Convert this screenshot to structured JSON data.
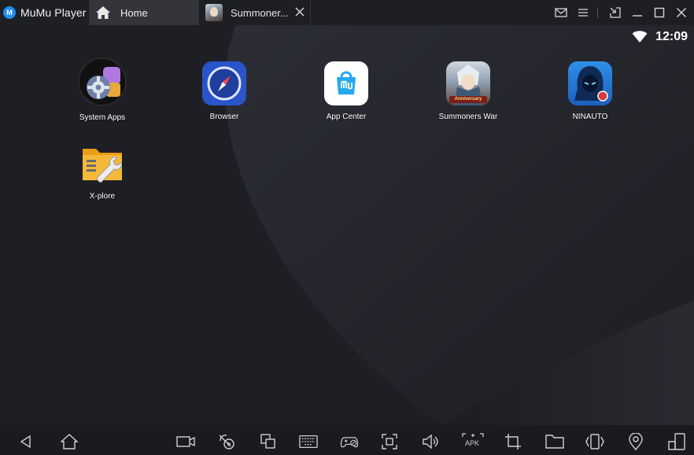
{
  "app": {
    "name": "MuMu Player",
    "logo_text": "M"
  },
  "tabs": [
    {
      "label": "Home"
    },
    {
      "label": "Summoner..."
    }
  ],
  "status": {
    "time": "12:09"
  },
  "apps": [
    {
      "label": "System Apps",
      "icon": "settings-gear-icon"
    },
    {
      "label": "Browser",
      "icon": "compass-icon"
    },
    {
      "label": "App Center",
      "icon": "shopping-bag-icon"
    },
    {
      "label": "Summoners War",
      "icon": "game-portrait-icon",
      "badge": "Anniversary"
    },
    {
      "label": "NINAUTO",
      "icon": "hooded-figure-icon"
    },
    {
      "label": "X-plore",
      "icon": "folder-wrench-icon"
    }
  ],
  "navbar": [
    "back-icon",
    "home-icon",
    "record-video-icon",
    "macro-icon",
    "multi-instance-icon",
    "keyboard-icon",
    "gamepad-icon",
    "fullscreen-icon",
    "volume-icon",
    "install-apk-icon",
    "crop-icon",
    "folder-icon",
    "shake-icon",
    "location-icon",
    "rotate-icon"
  ],
  "apk_label": "APK",
  "colors": {
    "accent": "#1c8ef2",
    "titlebar": "#1e1f23",
    "active_tab": "#34353b",
    "background": "#1b1c20"
  }
}
